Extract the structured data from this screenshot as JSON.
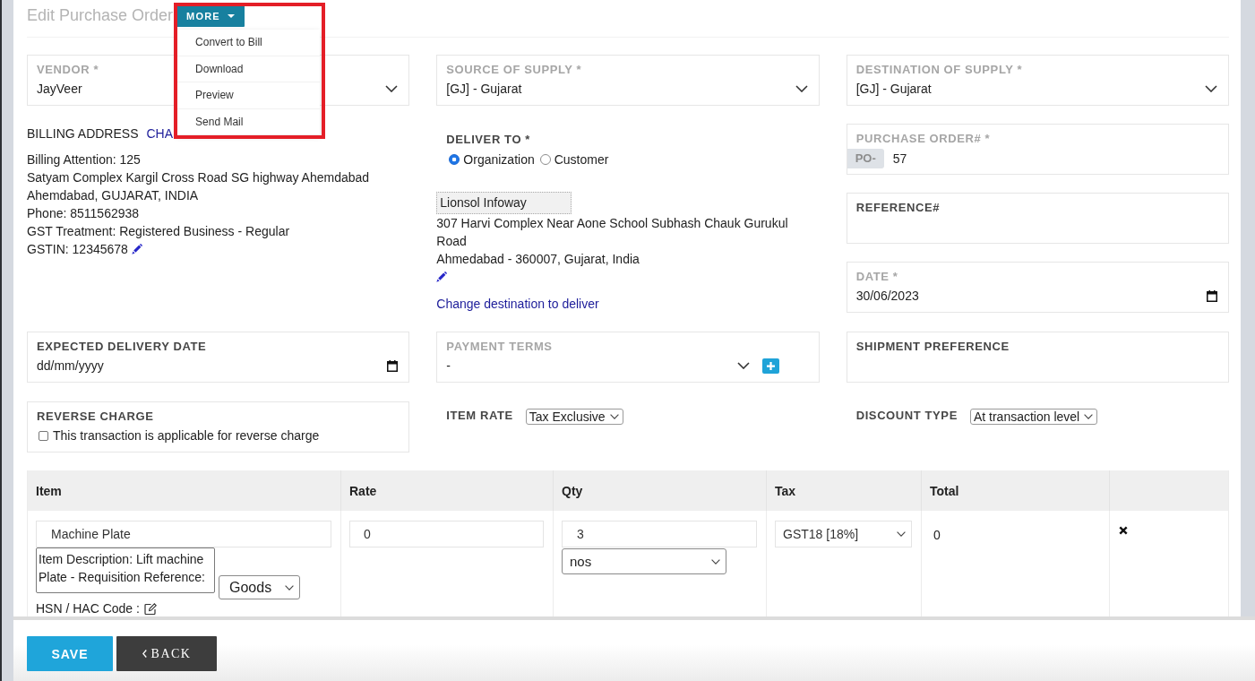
{
  "page": {
    "title": "Edit Purchase Order"
  },
  "more_menu": {
    "label": "MORE",
    "expanded": true,
    "highlighted": true,
    "items": [
      "Convert to Bill",
      "Download",
      "Preview",
      "Send Mail"
    ]
  },
  "vendor": {
    "label": "VENDOR *",
    "value": "JayVeer",
    "disabled": true
  },
  "source_of_supply": {
    "label": "SOURCE OF SUPPLY *",
    "value": "[GJ] - Gujarat",
    "disabled": true
  },
  "destination_of_supply": {
    "label": "DESTINATION OF SUPPLY *",
    "value": "[GJ] - Gujarat",
    "disabled": true
  },
  "billing_address": {
    "heading": "BILLING ADDRESS",
    "link": "CHA",
    "lines": [
      {
        "text": "Billing Attention: 125",
        "editable": false
      },
      {
        "text": "Satyam Complex Kargil Cross Road SG highway Ahemdabad",
        "editable": false
      },
      {
        "text": "Ahemdabad, GUJARAT, INDIA",
        "editable": false
      },
      {
        "text": "Phone: 8511562938",
        "editable": false
      },
      {
        "text": "GST Treatment: Registered Business - Regular",
        "editable": false
      },
      {
        "text": "GSTIN: 12345678",
        "editable": true
      }
    ]
  },
  "deliver_to": {
    "label": "DELIVER TO *",
    "options": [
      {
        "label": "Organization",
        "selected": true
      },
      {
        "label": "Customer",
        "selected": false
      }
    ],
    "name": "Lionsol Infoway",
    "address_lines": [
      "307 Harvi Complex Near Aone School Subhash Chauk Gurukul Road",
      "Ahmedabad - 360007, Gujarat, India"
    ],
    "editable": true,
    "link": "Change destination to deliver"
  },
  "purchase_order": {
    "label": "PURCHASE ORDER# *",
    "prefix": "PO-",
    "value": "57",
    "disabled": true
  },
  "reference": {
    "label": "REFERENCE#",
    "disabled": false
  },
  "date": {
    "label": "DATE *",
    "value": "30/06/2023",
    "disabled": true
  },
  "expected_delivery_date": {
    "label": "EXPECTED DELIVERY DATE",
    "placeholder": "dd/mm/yyyy",
    "disabled": false
  },
  "payment_terms": {
    "label": "PAYMENT TERMS",
    "value": "-",
    "disabled": true
  },
  "shipment_preference": {
    "label": "SHIPMENT PREFERENCE",
    "disabled": false
  },
  "reverse_charge": {
    "label": "REVERSE CHARGE",
    "option": "This transaction is applicable for reverse charge",
    "checked": false
  },
  "item_rate": {
    "label": "ITEM RATE",
    "value": "Tax Exclusive"
  },
  "discount_type": {
    "label": "DISCOUNT TYPE",
    "value": "At transaction level"
  },
  "items_table": {
    "columns": [
      "Item",
      "Rate",
      "Qty",
      "Tax",
      "Total"
    ],
    "rows": [
      {
        "item": "Machine Plate",
        "description": "Item Description: Lift machine Plate - Requisition Reference:",
        "type": "Goods",
        "hsn_label": "HSN / HAC Code :",
        "rate": "0",
        "qty": "3",
        "unit": "nos",
        "tax": "GST18 [18%]",
        "total": "0"
      }
    ]
  },
  "buttons": [
    {
      "label": "SAVE",
      "kind": "primary"
    },
    {
      "label": "BACK",
      "kind": "back"
    }
  ]
}
